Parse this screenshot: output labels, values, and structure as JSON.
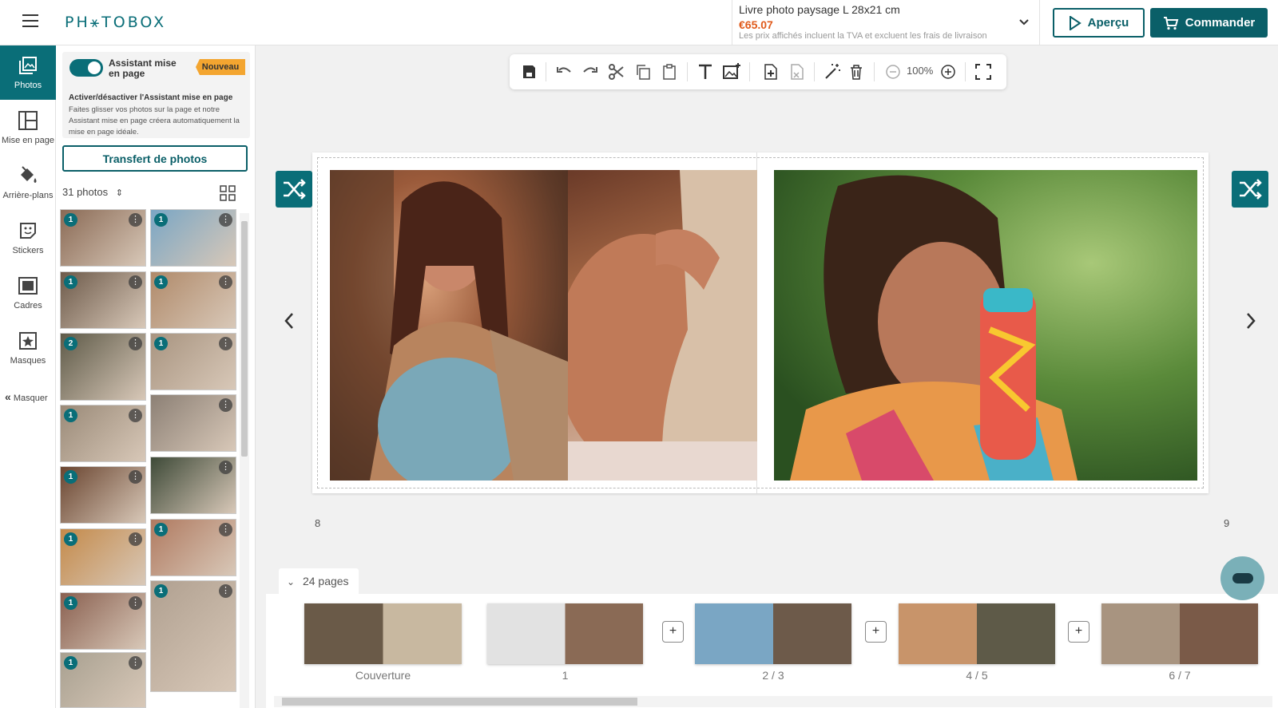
{
  "header": {
    "logo": "PH⚹TOBOX",
    "product_name": "Livre photo paysage L 28x21 cm",
    "price": "€65.07",
    "tax_note": "Les prix affichés incluent la TVA et excluent les frais de livraison",
    "preview_label": "Aperçu",
    "order_label": "Commander"
  },
  "nav": {
    "items": [
      {
        "label": "Photos",
        "icon": "photos-icon"
      },
      {
        "label": "Mise en page",
        "icon": "layout-icon"
      },
      {
        "label": "Arrière-plans",
        "icon": "paint-bucket-icon"
      },
      {
        "label": "Stickers",
        "icon": "sticker-icon"
      },
      {
        "label": "Cadres",
        "icon": "frame-icon"
      },
      {
        "label": "Masques",
        "icon": "mask-icon"
      }
    ],
    "hide_label": "Masquer"
  },
  "panel": {
    "assistant_title": "Assistant mise en page",
    "new_badge": "Nouveau",
    "assistant_heading": "Activer/désactiver l'Assistant mise en page",
    "assistant_desc": "Faites glisser vos photos sur la page et notre Assistant mise en page créera automatiquement la mise en page idéale.",
    "transfer_label": "Transfert de photos",
    "photo_count": "31 photos",
    "thumbnails": [
      {
        "count": "1",
        "color": "#8a6a55"
      },
      {
        "count": "1",
        "color": "#7aa6c4"
      },
      {
        "count": "1",
        "color": "#6d5a4a"
      },
      {
        "count": "1",
        "color": "#b08a6a"
      },
      {
        "count": "2",
        "color": "#5e5a48"
      },
      {
        "count": "1",
        "color": "#a89480"
      },
      {
        "count": "1",
        "color": "#9a8a78"
      },
      {
        "count": "",
        "color": "#8c8075"
      },
      {
        "count": "1",
        "color": "#6a4530"
      },
      {
        "count": "",
        "color": "#3e4a38"
      },
      {
        "count": "1",
        "color": "#c48a4a"
      },
      {
        "count": "1",
        "color": "#b07a60"
      },
      {
        "count": "1",
        "color": "#8a6050"
      },
      {
        "count": "1",
        "color": "#b0a090"
      },
      {
        "count": "1",
        "color": "#a8a090"
      }
    ]
  },
  "toolbar": {
    "zoom": "100%",
    "icons": [
      "save-icon",
      "undo-icon",
      "redo-icon",
      "cut-icon",
      "copy-icon",
      "paste-icon",
      "text-icon",
      "image-add-icon",
      "add-page-icon",
      "remove-page-icon",
      "magic-wand-icon",
      "delete-icon",
      "zoom-out-icon",
      "zoom-in-icon",
      "fullscreen-icon"
    ]
  },
  "spread": {
    "left_page_number": "8",
    "right_page_number": "9"
  },
  "pages": {
    "count_label": "24 pages",
    "thumbnails": [
      {
        "label": "Couverture"
      },
      {
        "label": "1"
      },
      {
        "label": "2 / 3"
      },
      {
        "label": "4 / 5"
      },
      {
        "label": "6 / 7"
      }
    ]
  },
  "colors": {
    "brand": "#0a6e78",
    "price": "#e05a1a",
    "badge": "#f3a530"
  }
}
